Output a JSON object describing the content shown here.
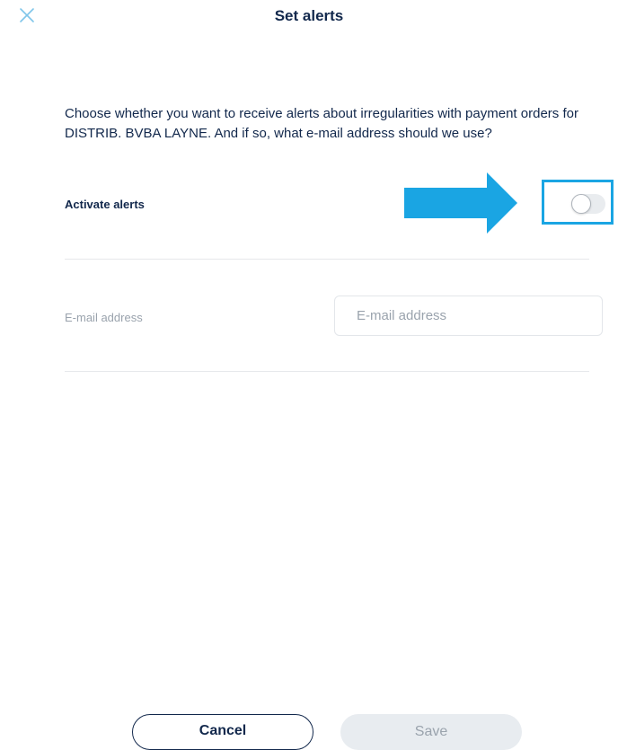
{
  "dialog": {
    "title": "Set alerts",
    "intro": "Choose whether you want to receive alerts about irregularities with payment orders for DISTRIB. BVBA LAYNE. And if so, what e-mail address should we use?"
  },
  "alerts": {
    "label": "Activate alerts",
    "toggle_on": false
  },
  "email": {
    "label": "E-mail address",
    "value": "",
    "placeholder": "E-mail address"
  },
  "footer": {
    "cancel_label": "Cancel",
    "save_label": "Save"
  },
  "icons": {
    "close": "close-icon",
    "arrow": "arrow-right-icon"
  },
  "colors": {
    "primary_text": "#12284c",
    "accent": "#1aa5e3",
    "muted": "#9aa3ad",
    "disabled_button_bg": "#e8ecf0"
  }
}
